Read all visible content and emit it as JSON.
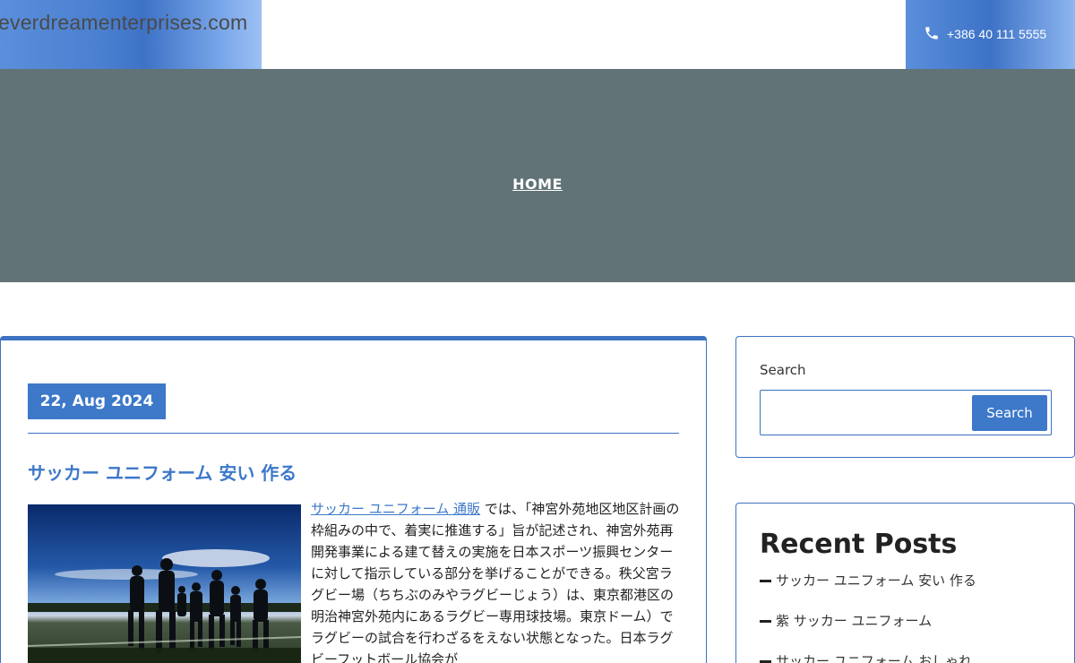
{
  "header": {
    "logo_text": "everdreamenterprises.com",
    "phone": "+386 40 111 5555"
  },
  "hero": {
    "breadcrumb_home": "HOME"
  },
  "article": {
    "date": "22, Aug 2024",
    "title": "サッカー ユニフォーム 安い 作る",
    "excerpt_link": "サッカー ユニフォーム 通販",
    "excerpt_text": " では、「神宮外苑地区地区計画の枠組みの中で、着実に推進する」旨が記述され、神宮外苑再開発事業による建て替えの実施を日本スポーツ振興センターに対して指示している部分を挙げることができる。秩父宮ラグビー場（ちちぶのみやラグビーじょう）は、東京都港区の明治神宮外苑内にあるラグビー専用球技場。東京ドーム）でラグビーの試合を行わざるをえない状態となった。日本ラグビーフットボール協会が"
  },
  "sidebar": {
    "search_label": "Search",
    "search_placeholder": "",
    "search_button": "Search",
    "recent_title": "Recent Posts",
    "recent_posts": [
      {
        "label": "サッカー ユニフォーム 安い 作る"
      },
      {
        "label": "紫 サッカー ユニフォーム"
      },
      {
        "label": "サッカー ユニフォーム おしゃれ"
      }
    ]
  },
  "colors": {
    "accent": "#3d78c9",
    "hero_bg": "#627377"
  },
  "icons": {
    "phone": "phone-icon"
  }
}
